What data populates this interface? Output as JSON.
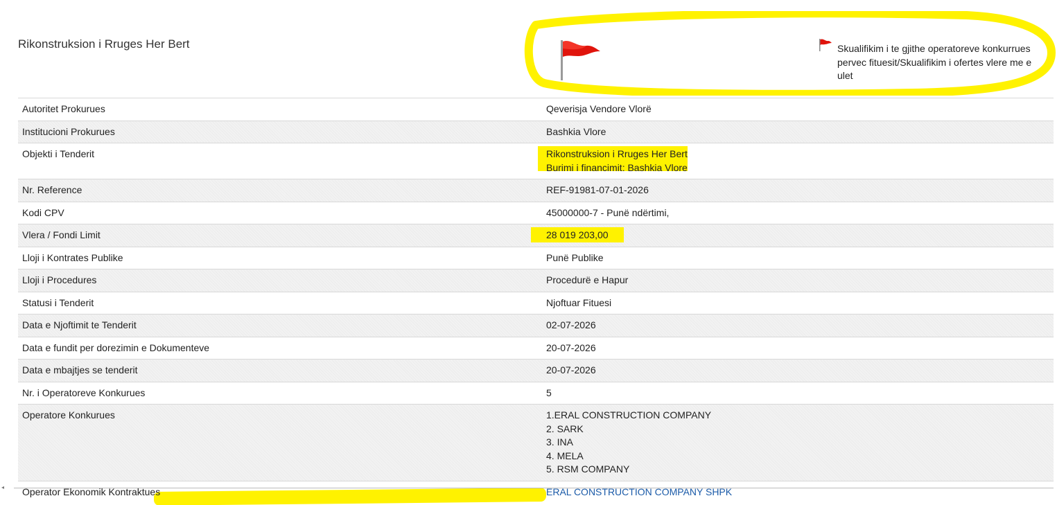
{
  "header": {
    "title": "Rikonstruksion i Rruges Her Bert",
    "flag_note": "Skualifikim i te gjithe operatoreve konkurrues pervec fituesit/Skualifikim i ofertes vlere me e ulet"
  },
  "details": {
    "rows": [
      {
        "label": "Autoritet Prokurues",
        "value": "Qeverisja Vendore Vlorë"
      },
      {
        "label": "Institucioni Prokurues",
        "value": "Bashkia Vlore"
      },
      {
        "label": "Objekti i Tenderit",
        "value_line1": "Rikonstruksion i Rruges Her Bert",
        "value_line2": "Burimi i financimit: Bashkia Vlore"
      },
      {
        "label": "Nr. Reference",
        "value": "REF-91981-07-01-2026"
      },
      {
        "label": "Kodi CPV",
        "value": "45000000-7 - Punë ndërtimi,"
      },
      {
        "label": "Vlera / Fondi Limit",
        "value": "28 019 203,00"
      },
      {
        "label": "Lloji i Kontrates Publike",
        "value": "Punë Publike"
      },
      {
        "label": "Lloji i Procedures",
        "value": "Procedurë e Hapur"
      },
      {
        "label": "Statusi i Tenderit",
        "value": "Njoftuar Fituesi"
      },
      {
        "label": "Data e Njoftimit te Tenderit",
        "value": "02-07-2026"
      },
      {
        "label": "Data e fundit per dorezimin e Dokumenteve",
        "value": "20-07-2026"
      },
      {
        "label": "Data e mbajtjes se tenderit",
        "value": "20-07-2026"
      },
      {
        "label": "Nr. i Operatoreve Konkurues",
        "value": "5"
      },
      {
        "label": "Operatore Konkurues",
        "values": [
          "1.ERAL CONSTRUCTION COMPANY",
          "2. SARK",
          "3. INA",
          "4. MELA",
          "5. RSM COMPANY"
        ]
      },
      {
        "label": "Operator Ekonomik Kontraktues",
        "value": "ERAL CONSTRUCTION COMPANY SHPK"
      }
    ]
  },
  "colors": {
    "highlight": "#fff200",
    "flag_red": "#e0140c",
    "link": "#1a5aa8"
  },
  "icons": [
    "red-flag-icon"
  ]
}
